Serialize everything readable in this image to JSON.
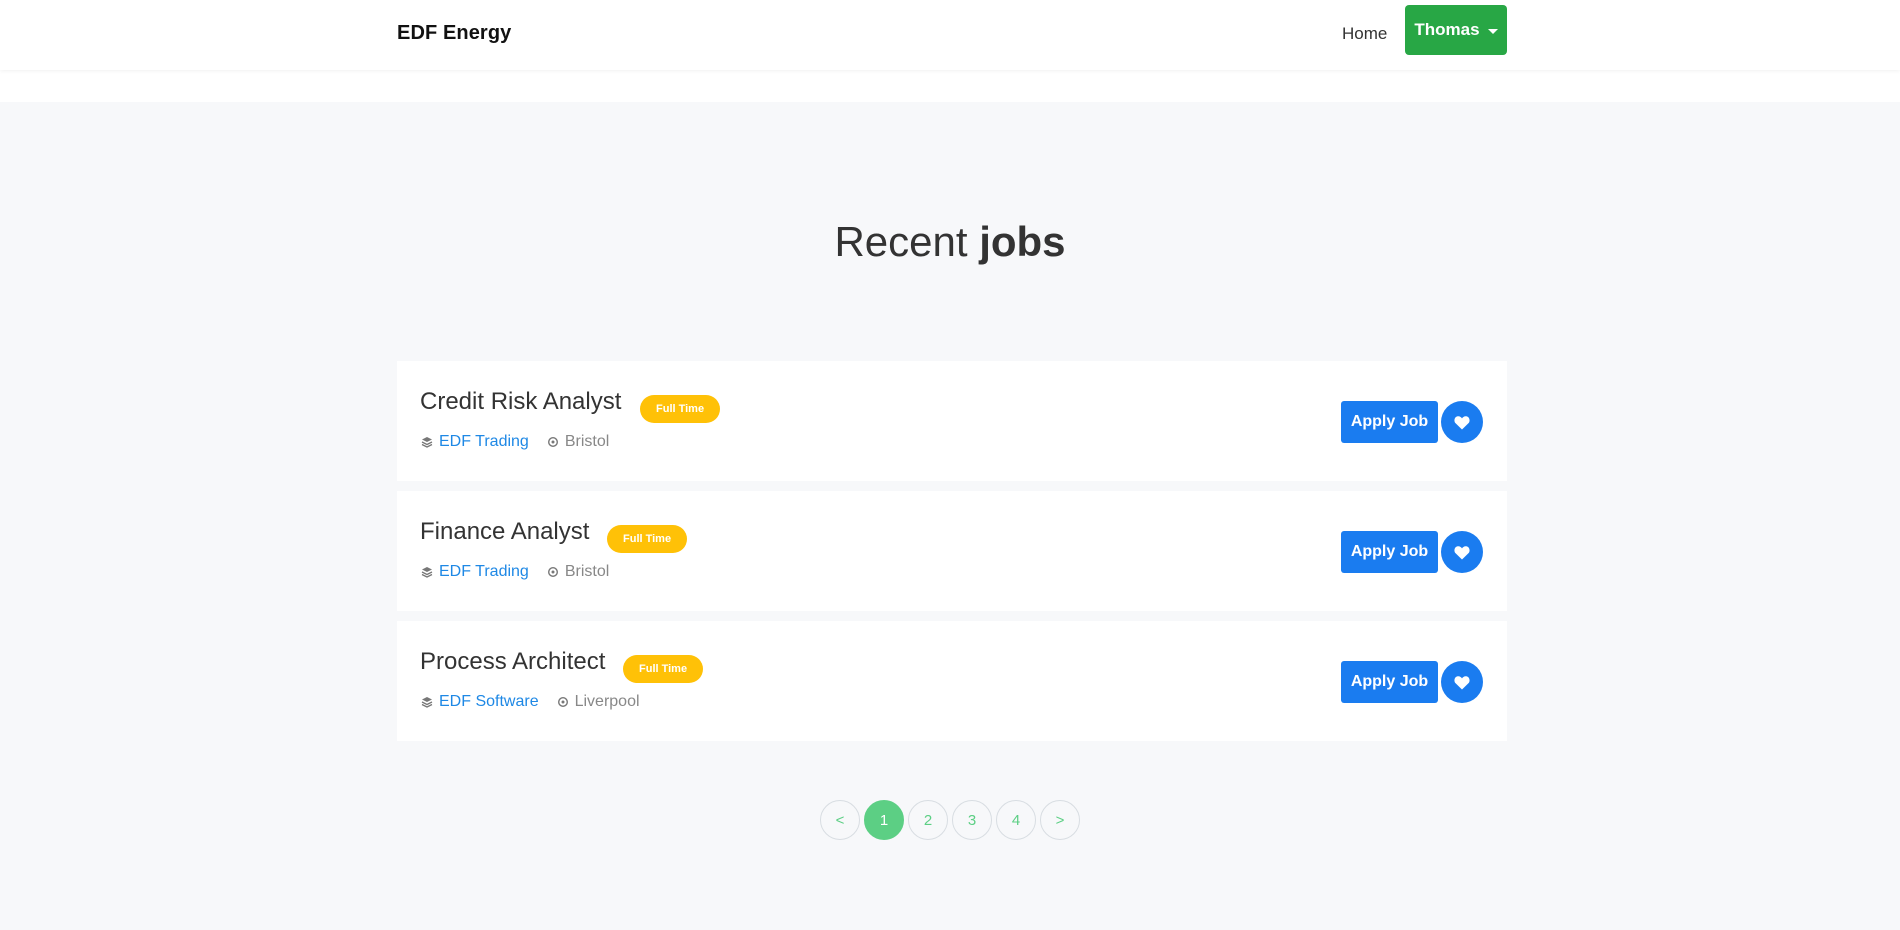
{
  "navbar": {
    "brand": "EDF Energy",
    "home_label": "Home",
    "user_label": "Thomas"
  },
  "section": {
    "title_regular": "Recent ",
    "title_bold": "jobs"
  },
  "jobs": [
    {
      "title": "Credit Risk Analyst",
      "type": "Full Time",
      "company": "EDF Trading",
      "location": "Bristol",
      "apply_label": "Apply Job"
    },
    {
      "title": "Finance Analyst",
      "type": "Full Time",
      "company": "EDF Trading",
      "location": "Bristol",
      "apply_label": "Apply Job"
    },
    {
      "title": "Process Architect",
      "type": "Full Time",
      "company": "EDF Software",
      "location": "Liverpool",
      "apply_label": "Apply Job"
    }
  ],
  "pagination": {
    "prev": "<",
    "pages": [
      "1",
      "2",
      "3",
      "4"
    ],
    "next": ">",
    "active": "1"
  },
  "colors": {
    "accent_green": "#28a745",
    "primary_blue": "#1a7cf0",
    "badge_yellow": "#ffc107",
    "pagination_green": "#5ccf84"
  },
  "icons": {
    "company": "layers-icon",
    "location": "location-pin-icon",
    "favorite": "heart-icon",
    "dropdown": "caret-down-icon"
  }
}
